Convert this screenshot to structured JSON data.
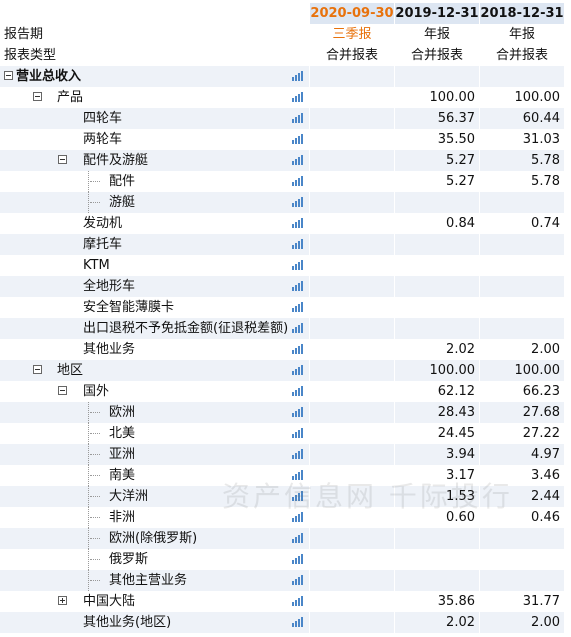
{
  "header": {
    "period_label": "报告期",
    "type_label": "报表类型",
    "dates": [
      "2020-09-30",
      "2019-12-31",
      "2018-12-31"
    ],
    "periods": [
      "三季报",
      "年报",
      "年报"
    ],
    "types": [
      "合并报表",
      "合并报表",
      "合并报表"
    ]
  },
  "rows": [
    {
      "label": "营业总收入",
      "v": [
        "",
        "",
        ""
      ]
    },
    {
      "label": "产品",
      "v": [
        "",
        "100.00",
        "100.00"
      ]
    },
    {
      "label": "四轮车",
      "v": [
        "",
        "56.37",
        "60.44"
      ]
    },
    {
      "label": "两轮车",
      "v": [
        "",
        "35.50",
        "31.03"
      ]
    },
    {
      "label": "配件及游艇",
      "v": [
        "",
        "5.27",
        "5.78"
      ]
    },
    {
      "label": "配件",
      "v": [
        "",
        "5.27",
        "5.78"
      ]
    },
    {
      "label": "游艇",
      "v": [
        "",
        "",
        ""
      ]
    },
    {
      "label": "发动机",
      "v": [
        "",
        "0.84",
        "0.74"
      ]
    },
    {
      "label": "摩托车",
      "v": [
        "",
        "",
        ""
      ]
    },
    {
      "label": "KTM",
      "v": [
        "",
        "",
        ""
      ]
    },
    {
      "label": "全地形车",
      "v": [
        "",
        "",
        ""
      ]
    },
    {
      "label": "安全智能薄膜卡",
      "v": [
        "",
        "",
        ""
      ]
    },
    {
      "label": "出口退税不予免抵金额(征退税差额)",
      "v": [
        "",
        "",
        ""
      ]
    },
    {
      "label": "其他业务",
      "v": [
        "",
        "2.02",
        "2.00"
      ]
    },
    {
      "label": "地区",
      "v": [
        "",
        "100.00",
        "100.00"
      ]
    },
    {
      "label": "国外",
      "v": [
        "",
        "62.12",
        "66.23"
      ]
    },
    {
      "label": "欧洲",
      "v": [
        "",
        "28.43",
        "27.68"
      ]
    },
    {
      "label": "北美",
      "v": [
        "",
        "24.45",
        "27.22"
      ]
    },
    {
      "label": "亚洲",
      "v": [
        "",
        "3.94",
        "4.97"
      ]
    },
    {
      "label": "南美",
      "v": [
        "",
        "3.17",
        "3.46"
      ]
    },
    {
      "label": "大洋洲",
      "v": [
        "",
        "1.53",
        "2.44"
      ]
    },
    {
      "label": "非洲",
      "v": [
        "",
        "0.60",
        "0.46"
      ]
    },
    {
      "label": "欧洲(除俄罗斯)",
      "v": [
        "",
        "",
        ""
      ]
    },
    {
      "label": "俄罗斯",
      "v": [
        "",
        "",
        ""
      ]
    },
    {
      "label": "其他主营业务",
      "v": [
        "",
        "",
        ""
      ]
    },
    {
      "label": "中国大陆",
      "v": [
        "",
        "35.86",
        "31.77"
      ]
    },
    {
      "label": "其他业务(地区)",
      "v": [
        "",
        "2.02",
        "2.00"
      ]
    }
  ],
  "watermark": "资产信息网 千际投行",
  "colors": {
    "accent_date": "#e8720c",
    "row_alt": "#eef2f8",
    "chart_icon": "#4a86c8"
  }
}
